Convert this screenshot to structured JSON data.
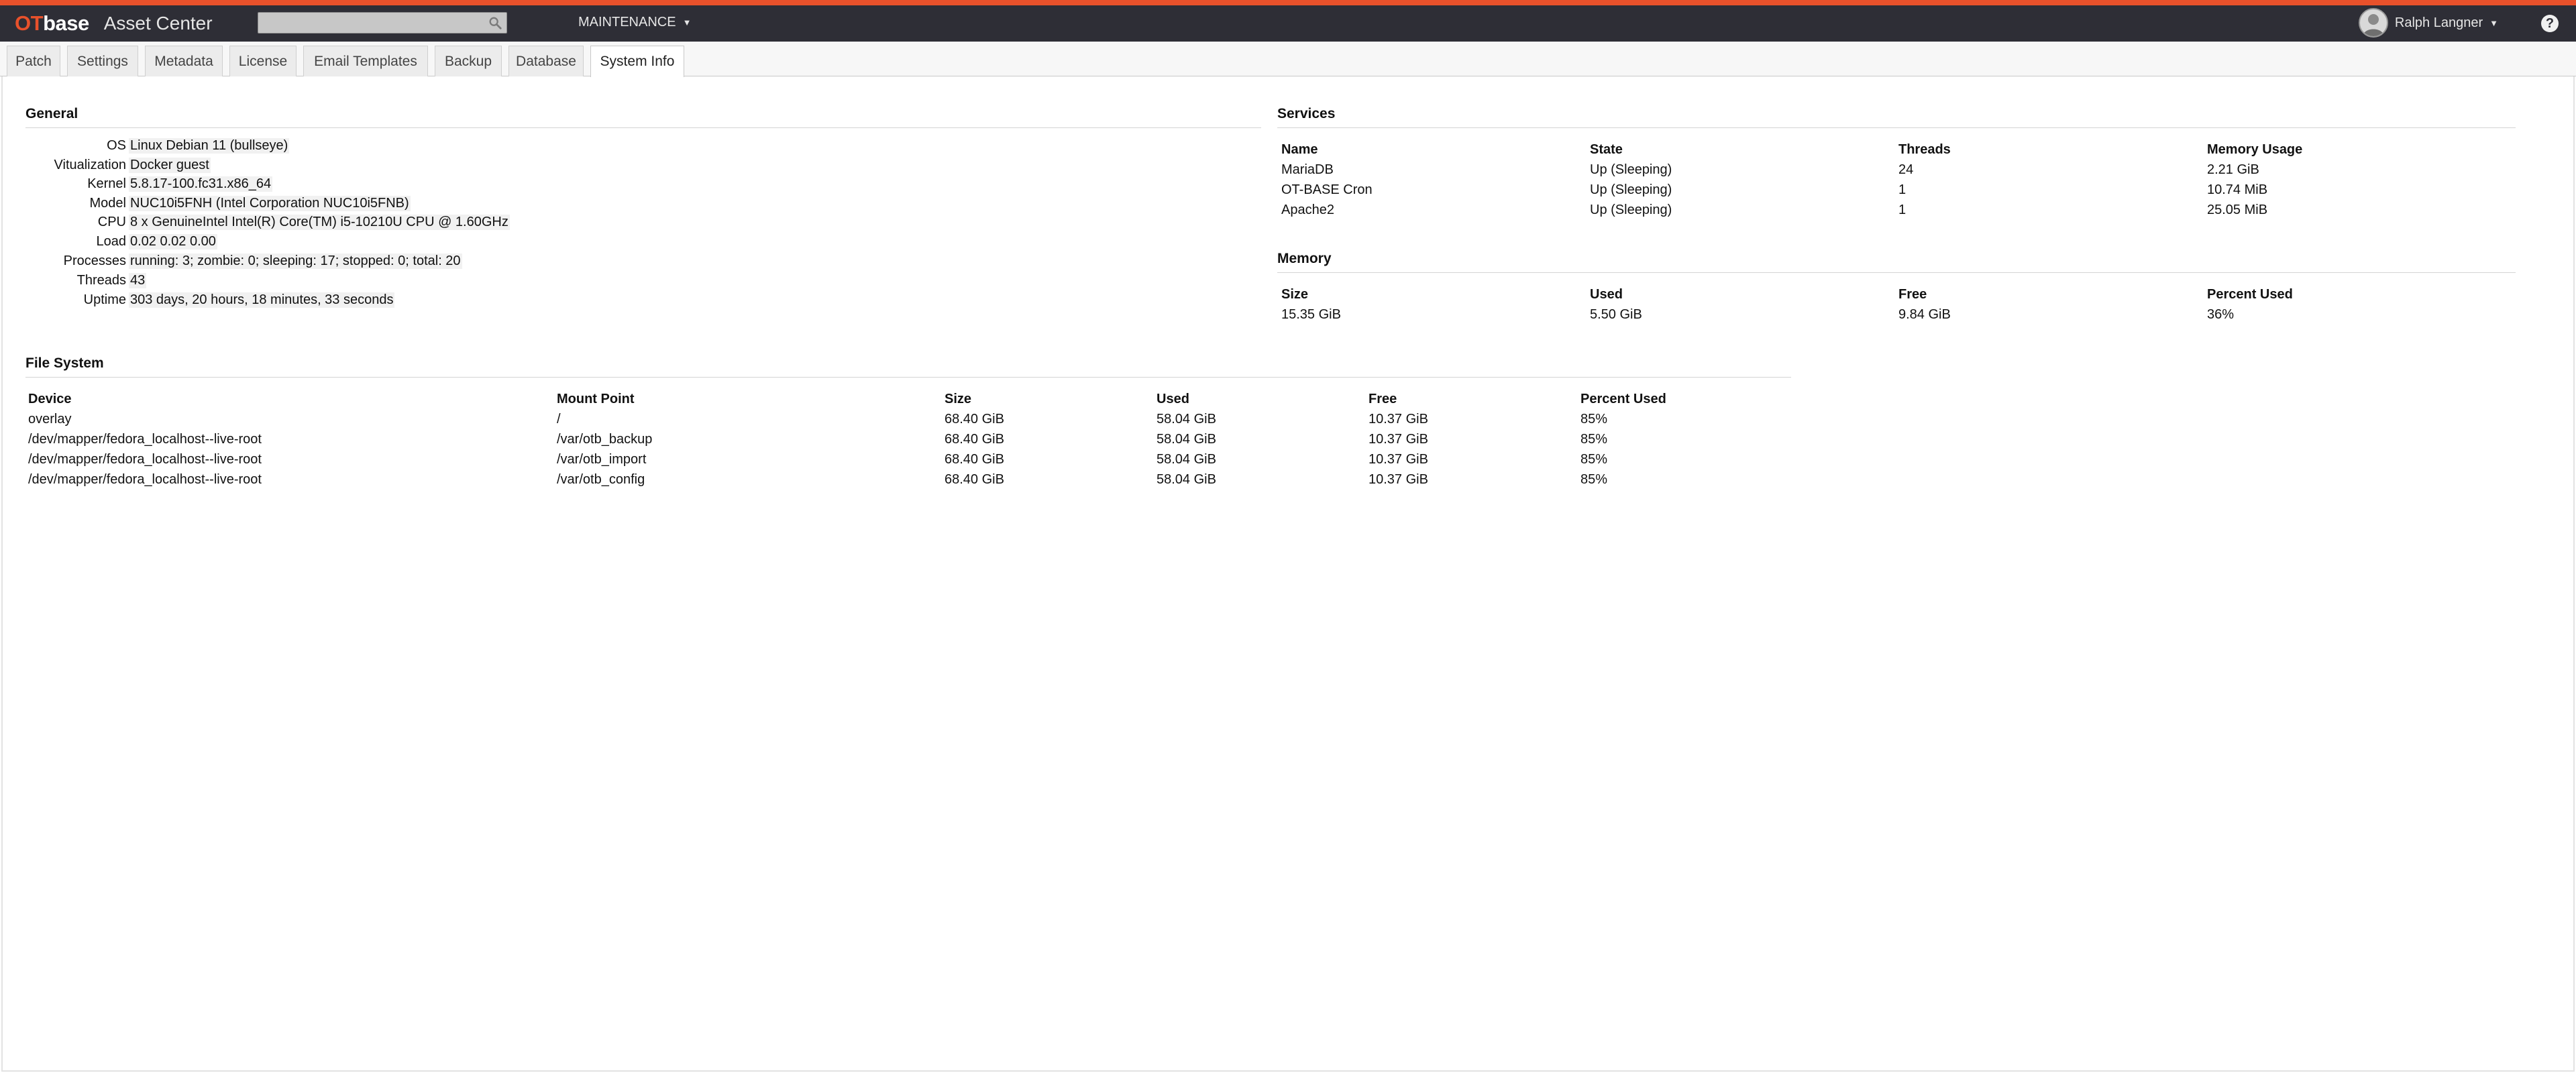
{
  "colors": {
    "accent": "#e8512b",
    "topbar": "#2e2e36"
  },
  "header": {
    "logo_ot": "OT",
    "logo_base": "base",
    "app_title": "Asset Center",
    "search_placeholder": "",
    "menu_label": "MAINTENANCE",
    "user_name": "Ralph Langner",
    "help_label": "?"
  },
  "tabs": [
    "Patch",
    "Settings",
    "Metadata",
    "License",
    "Email Templates",
    "Backup",
    "Database",
    "System Info"
  ],
  "active_tab": "System Info",
  "general": {
    "title": "General",
    "rows": [
      {
        "label": "OS",
        "value": "Linux Debian 11 (bullseye)"
      },
      {
        "label": "Vitualization",
        "value": "Docker guest"
      },
      {
        "label": "Kernel",
        "value": "5.8.17-100.fc31.x86_64"
      },
      {
        "label": "Model",
        "value": "NUC10i5FNH (Intel Corporation NUC10i5FNB)"
      },
      {
        "label": "CPU",
        "value": "8 x GenuineIntel Intel(R) Core(TM) i5-10210U CPU @ 1.60GHz"
      },
      {
        "label": "Load",
        "value": "0.02 0.02 0.00"
      },
      {
        "label": "Processes",
        "value": "running: 3; zombie: 0; sleeping: 17; stopped: 0; total: 20"
      },
      {
        "label": "Threads",
        "value": "43"
      },
      {
        "label": "Uptime",
        "value": "303 days, 20 hours, 18 minutes, 33 seconds"
      }
    ]
  },
  "services": {
    "title": "Services",
    "columns": [
      "Name",
      "State",
      "Threads",
      "Memory Usage"
    ],
    "rows": [
      [
        "MariaDB",
        "Up (Sleeping)",
        "24",
        "2.21 GiB"
      ],
      [
        "OT-BASE Cron",
        "Up (Sleeping)",
        "1",
        "10.74 MiB"
      ],
      [
        "Apache2",
        "Up (Sleeping)",
        "1",
        "25.05 MiB"
      ]
    ]
  },
  "memory": {
    "title": "Memory",
    "columns": [
      "Size",
      "Used",
      "Free",
      "Percent Used"
    ],
    "rows": [
      [
        "15.35 GiB",
        "5.50 GiB",
        "9.84 GiB",
        "36%"
      ]
    ]
  },
  "filesystem": {
    "title": "File System",
    "columns": [
      "Device",
      "Mount Point",
      "Size",
      "Used",
      "Free",
      "Percent Used"
    ],
    "rows": [
      [
        "overlay",
        "/",
        "68.40 GiB",
        "58.04 GiB",
        "10.37 GiB",
        "85%"
      ],
      [
        "/dev/mapper/fedora_localhost--live-root",
        "/var/otb_backup",
        "68.40 GiB",
        "58.04 GiB",
        "10.37 GiB",
        "85%"
      ],
      [
        "/dev/mapper/fedora_localhost--live-root",
        "/var/otb_import",
        "68.40 GiB",
        "58.04 GiB",
        "10.37 GiB",
        "85%"
      ],
      [
        "/dev/mapper/fedora_localhost--live-root",
        "/var/otb_config",
        "68.40 GiB",
        "58.04 GiB",
        "10.37 GiB",
        "85%"
      ]
    ]
  }
}
